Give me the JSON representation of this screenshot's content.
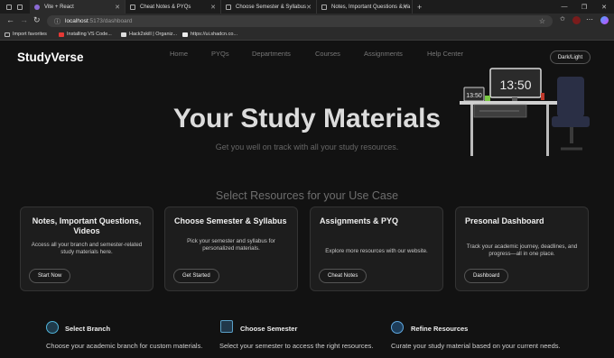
{
  "browser": {
    "tabs": [
      {
        "label": "Vite + React"
      },
      {
        "label": "Cheat Notes & PYQs"
      },
      {
        "label": "Choose Semester & Syllabus"
      },
      {
        "label": "Notes, Important Questions & Va"
      }
    ],
    "url_host": "localhost",
    "url_path": ":5173/dashboard",
    "bookmarks": [
      {
        "label": "Import favorites"
      },
      {
        "label": "Installing VS Code..."
      },
      {
        "label": "Hack2skill | Organiz..."
      },
      {
        "label": "https://ui.shadcn.co..."
      }
    ]
  },
  "header": {
    "logo": "StudyVerse",
    "nav": [
      "Home",
      "PYQs",
      "Departments",
      "Courses",
      "Assignments",
      "Help Center"
    ],
    "theme_toggle": "Dark/Light"
  },
  "hero": {
    "title": "Your Study Materials",
    "subtitle": "Get you well on track with all your study resources.",
    "clock_big": "13:50",
    "clock_small": "13:50"
  },
  "resources": {
    "section_title": "Select Resources for your Use Case",
    "cards": [
      {
        "title": "Notes, Important Questions, Videos",
        "desc": "Access all your branch and semester-related study materials here.",
        "button": "Start Now"
      },
      {
        "title": "Choose Semester & Syllabus",
        "desc": "Pick your semester and syllabus for personalized materials.",
        "button": "Get Started"
      },
      {
        "title": "Assignments & PYQ",
        "desc": "Explore more resources with our website.",
        "button": "Cheat Notes"
      },
      {
        "title": "Presonal Dashboard",
        "desc": "Track your academic journey, deadlines, and progress—all in one place.",
        "button": "Dashboard"
      }
    ]
  },
  "features": [
    {
      "icon": "branch-icon",
      "title": "Select Branch",
      "desc": "Choose your academic branch for custom materials."
    },
    {
      "icon": "semester-icon",
      "title": "Choose Semester",
      "desc": "Select your semester to access the right resources."
    },
    {
      "icon": "globe-icon",
      "title": "Refine Resources",
      "desc": "Curate your study material based on your current needs."
    }
  ]
}
